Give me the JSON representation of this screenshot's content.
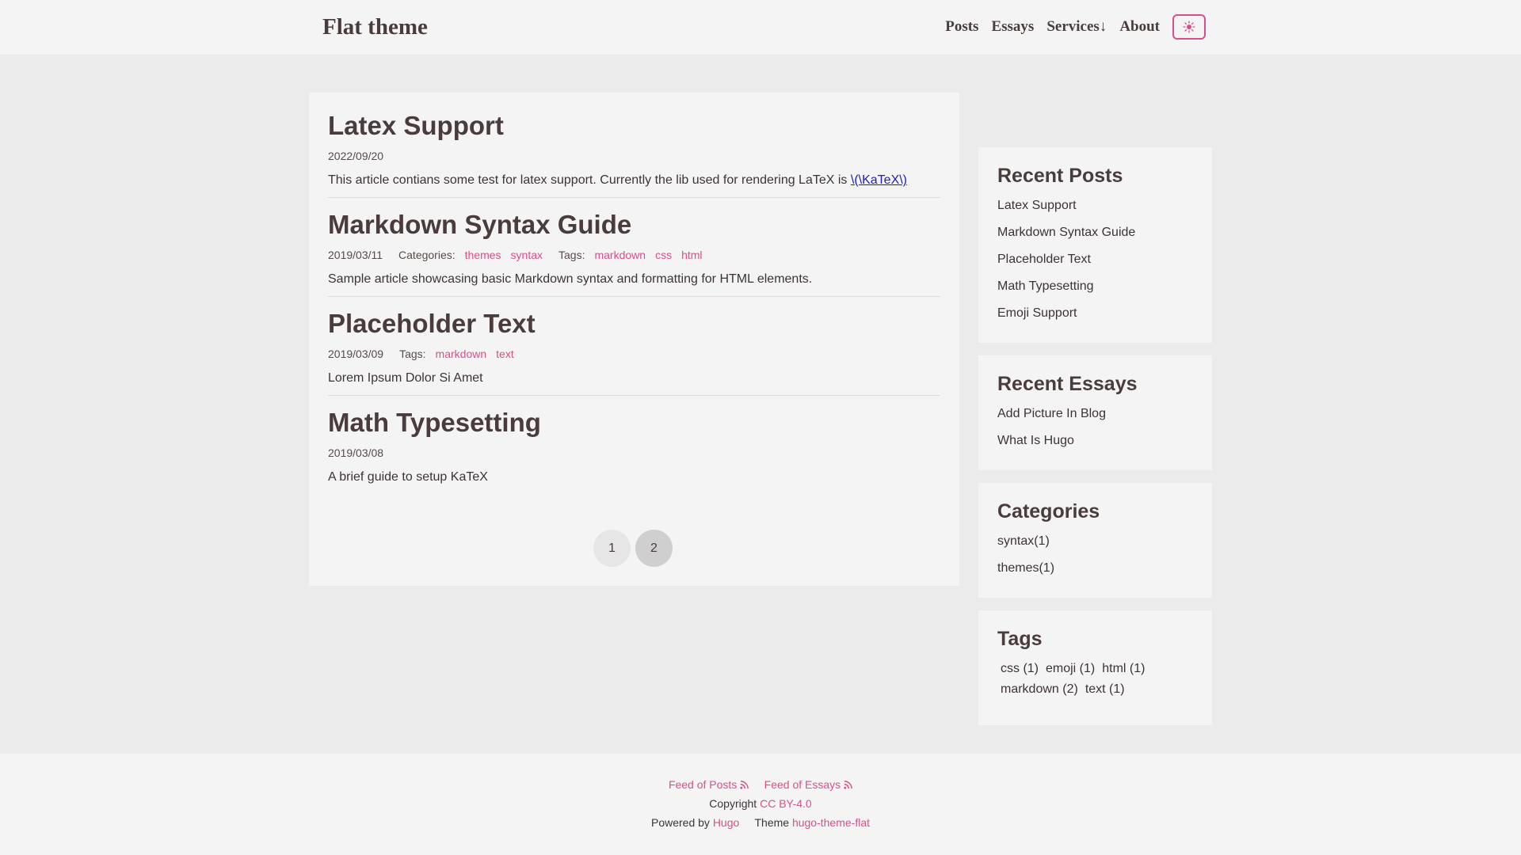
{
  "header": {
    "title": "Flat theme",
    "nav": [
      "Posts",
      "Essays",
      "Services↓",
      "About"
    ],
    "accent_color": "#d94f8c",
    "toggle_icon": "sun-icon"
  },
  "posts": [
    {
      "title": "Latex Support",
      "date": "2022/09/20",
      "summary": "This article contians some test for latex support. Currently the lib used for rendering LaTeX is",
      "link": "\\(\\KaTeX\\)"
    },
    {
      "title": "Markdown Syntax Guide",
      "date": "2019/03/11",
      "categories_label": "Categories:",
      "categories": [
        "themes",
        "syntax"
      ],
      "tags_label": "Tags:",
      "tags": [
        "markdown",
        "css",
        "html"
      ],
      "summary": "Sample article showcasing basic Markdown syntax and formatting for HTML elements."
    },
    {
      "title": "Placeholder Text",
      "date": "2019/03/09",
      "tags_label": "Tags:",
      "tags": [
        "markdown",
        "text"
      ],
      "summary": "Lorem Ipsum Dolor Si Amet"
    },
    {
      "title": "Math Typesetting",
      "date": "2019/03/08",
      "summary": "A brief guide to setup KaTeX"
    }
  ],
  "pagination": [
    "1",
    "2"
  ],
  "sidebar": {
    "recent_posts": {
      "title": "Recent Posts",
      "items": [
        "Latex Support",
        "Markdown Syntax Guide",
        "Placeholder Text",
        "Math Typesetting",
        "Emoji Support"
      ]
    },
    "recent_essays": {
      "title": "Recent Essays",
      "items": [
        "Add Picture In Blog",
        "What Is Hugo"
      ]
    },
    "categories": {
      "title": "Categories",
      "items": [
        "syntax(1)",
        "themes(1)"
      ]
    },
    "tags": {
      "title": "Tags",
      "items": [
        "css (1)",
        "emoji (1)",
        "html (1)",
        "markdown (2)",
        "text (1)"
      ]
    }
  },
  "footer": {
    "feed_posts": "Feed of Posts",
    "feed_essays": "Feed of Essays",
    "copyright_label": "Copyright",
    "license": "CC BY-4.0",
    "powered_label": "Powered by",
    "hugo": "Hugo",
    "theme_label": "Theme",
    "theme_name": "hugo-theme-flat"
  }
}
